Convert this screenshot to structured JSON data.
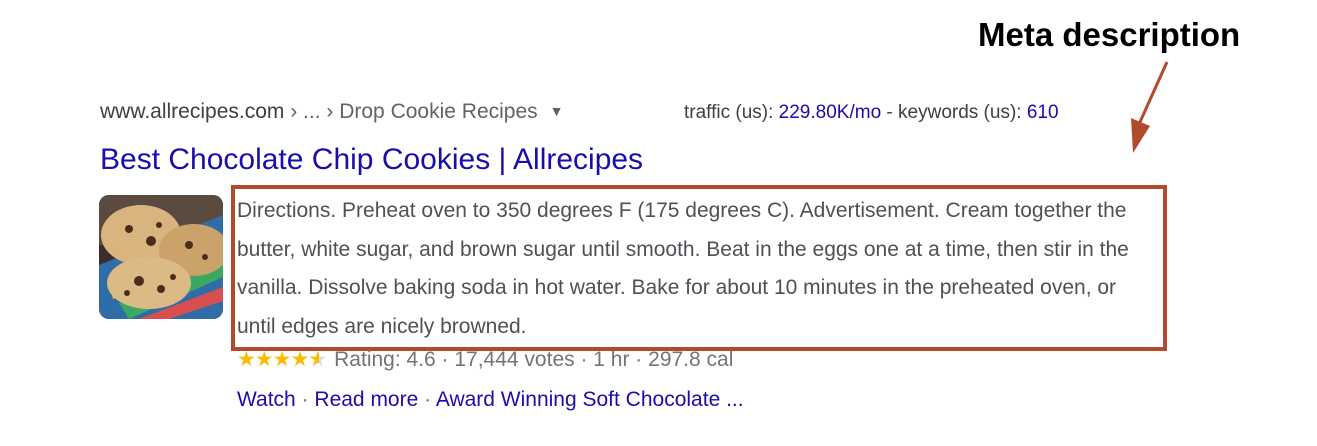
{
  "annotation": {
    "label": "Meta description",
    "arrow_color": "#b24a2b",
    "box_color": "#b24a2b"
  },
  "result": {
    "breadcrumb": {
      "domain": "www.allrecipes.com",
      "path": " › ... › Drop Cookie Recipes",
      "menu_icon": "triangle-down-icon"
    },
    "seo_metrics": {
      "traffic_label": "traffic (us): ",
      "traffic_value": "229.80K/mo",
      "separator": " - ",
      "keywords_label": "keywords (us): ",
      "keywords_value": "610"
    },
    "title": "Best Chocolate Chip Cookies | Allrecipes",
    "thumbnail": "chocolate-chip-cookies-image",
    "description": "Directions. Preheat oven to 350 degrees F (175 degrees C). Advertisement. Cream together the butter, white sugar, and brown sugar until smooth. Beat in the eggs one at a time, then stir in the vanilla. Dissolve baking soda in hot water. Bake for about 10 minutes in the preheated oven, or until edges are nicely browned.",
    "rating": {
      "stars_value": 4.6,
      "stars_max": 5,
      "stars_glyphs": "★★★★",
      "text": "Rating: 4.6 · 17,444 votes · 1 hr · 297.8 cal"
    },
    "sitelinks": {
      "watch": "Watch",
      "read_more": "Read more",
      "related": "Award Winning Soft Chocolate ...",
      "separator": " · "
    },
    "colors": {
      "link": "#1a0dab",
      "star": "#fbbc04",
      "snippet": "#4d5156"
    }
  }
}
